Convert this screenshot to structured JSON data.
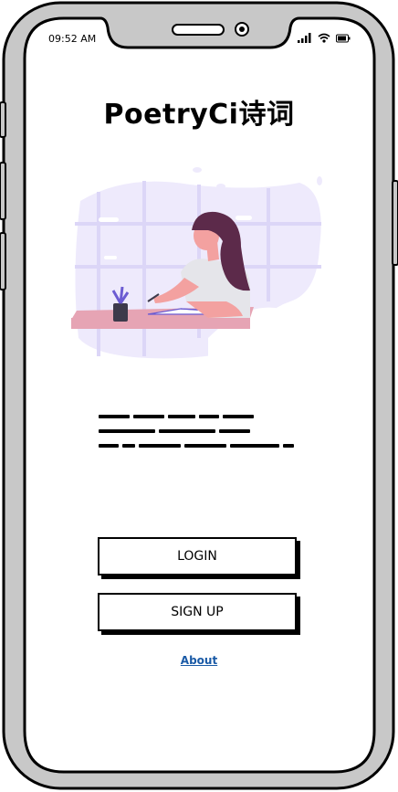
{
  "status_bar": {
    "time": "09:52 AM",
    "icons": [
      "signal-icon",
      "wifi-icon",
      "battery-icon"
    ]
  },
  "app": {
    "title": "PoetryCi诗词"
  },
  "intro": {
    "placeholder_text_lines": 3
  },
  "actions": {
    "login_label": "LOGIN",
    "signup_label": "SIGN UP",
    "about_label": "About"
  },
  "colors": {
    "frame_gray": "#c8c8c8",
    "illustration_bg": "#eeeafc",
    "illustration_accent": "#dcd6f7",
    "desk": "#e6a4b4",
    "hair": "#5c2a4a",
    "shirt": "#e5e5ea",
    "skin": "#f3a1a0",
    "link": "#1a5aa6"
  }
}
